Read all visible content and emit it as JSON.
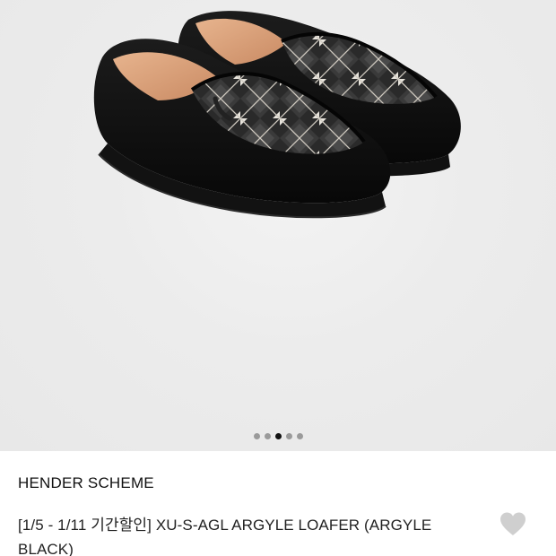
{
  "product": {
    "brand": "HENDER SCHEME",
    "title": "[1/5 - 1/11 기간할인] XU-S-AGL ARGYLE LOAFER (ARGYLE BLACK)",
    "image_alt": "XU-S-AGL ARGYLE LOAFER"
  },
  "gallery": {
    "dot_count": 5,
    "active_dot_index": 2
  },
  "icons": {
    "wishlist": "heart-icon"
  },
  "colors": {
    "gallery_background": "#ebebeb",
    "active_dot": "#111111",
    "inactive_dot": "#9a9a9a",
    "heart": "#cfcfcf"
  }
}
